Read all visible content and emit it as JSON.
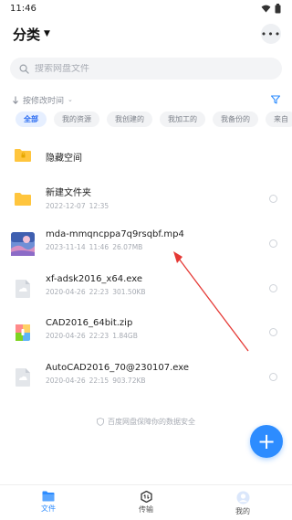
{
  "status_bar": {
    "time": "11:46",
    "icons": [
      "wifi-icon",
      "battery-icon"
    ]
  },
  "header": {
    "title": "分类",
    "more_icon": "more-dots-icon"
  },
  "search": {
    "placeholder": "搜索网盘文件",
    "value": ""
  },
  "sort": {
    "label": "按修改时间"
  },
  "chips": [
    {
      "label": "全部",
      "active": true
    },
    {
      "label": "我的资源",
      "active": false
    },
    {
      "label": "我创建的",
      "active": false
    },
    {
      "label": "我加工的",
      "active": false
    },
    {
      "label": "我备份的",
      "active": false
    },
    {
      "label": "来自",
      "active": false
    }
  ],
  "files": [
    {
      "name": "隐藏空间",
      "date": "",
      "time": "",
      "size": "",
      "icon": "hidden-folder-icon"
    },
    {
      "name": "新建文件夹",
      "date": "2022-12-07",
      "time": "12:35",
      "size": "",
      "icon": "folder-icon"
    },
    {
      "name": "mda-mmqncppa7q9rsqbf.mp4",
      "date": "2023-11-14",
      "time": "11:46",
      "size": "26.07MB",
      "icon": "video-thumbnail-icon"
    },
    {
      "name": "xf-adsk2016_x64.exe",
      "date": "2020-04-26",
      "time": "22:23",
      "size": "301.50KB",
      "icon": "exe-file-icon"
    },
    {
      "name": "CAD2016_64bit.zip",
      "date": "2020-04-26",
      "time": "22:23",
      "size": "1.84GB",
      "icon": "zip-file-icon"
    },
    {
      "name": "AutoCAD2016_70@230107.exe",
      "date": "2020-04-26",
      "time": "22:15",
      "size": "903.72KB",
      "icon": "exe-file-icon"
    }
  ],
  "security_note": "百度网盘保障你的数据安全",
  "bottom_nav": [
    {
      "label": "文件",
      "icon": "file-icon",
      "active": true
    },
    {
      "label": "传输",
      "icon": "transfer-icon",
      "active": false
    },
    {
      "label": "我的",
      "icon": "avatar-icon",
      "active": false
    }
  ],
  "colors": {
    "accent": "#2d8cff",
    "folder": "#ffc53d",
    "arrow": "#e53935"
  }
}
